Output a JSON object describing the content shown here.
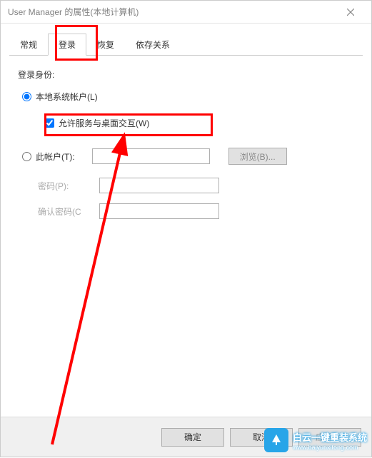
{
  "window": {
    "title": "User Manager 的属性(本地计算机)"
  },
  "tabs": {
    "items": [
      {
        "label": "常规"
      },
      {
        "label": "登录"
      },
      {
        "label": "恢复"
      },
      {
        "label": "依存关系"
      }
    ],
    "active_index": 1
  },
  "login_panel": {
    "section_label": "登录身份:",
    "local_system_label": "本地系统帐户(L)",
    "allow_desktop_label": "允许服务与桌面交互(W)",
    "allow_desktop_checked": true,
    "this_account_label": "此帐户(T):",
    "this_account_value": "",
    "browse_label": "浏览(B)...",
    "password_label": "密码(P):",
    "password_value": "",
    "confirm_password_label": "确认密码(C",
    "confirm_password_value": ""
  },
  "buttons": {
    "ok": "确定",
    "cancel": "取消",
    "apply": "应用(A)"
  },
  "watermark": {
    "main": "白云一键重装系统",
    "sub": "www.baiyunxitong.com"
  }
}
